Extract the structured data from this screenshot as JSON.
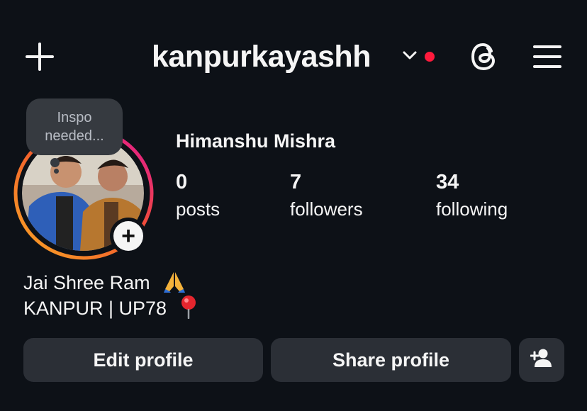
{
  "header": {
    "username": "kanpurkayashh",
    "icons": [
      "plus-icon",
      "chevron-down-icon",
      "threads-icon",
      "menu-icon"
    ],
    "notification_dot_color": "#ff1a3c"
  },
  "note": {
    "text_line1": "Inspo",
    "text_line2": "needed..."
  },
  "profile": {
    "full_name": "Himanshu Mishra",
    "stats": {
      "posts_count": "0",
      "posts_label": "posts",
      "followers_count": "7",
      "followers_label": "followers",
      "following_count": "34",
      "following_label": "following"
    },
    "bio_line1": "Jai Shree Ram",
    "bio_line2": "KANPUR | UP78"
  },
  "actions": {
    "edit_label": "Edit profile",
    "share_label": "Share profile",
    "add_user_icon": "person-plus-icon"
  },
  "colors": {
    "background": "#0d1117",
    "button_bg": "#2b2f36",
    "text": "#f5f5f5",
    "story_ring_start": "#f9a825",
    "story_ring_end": "#e1139d"
  }
}
